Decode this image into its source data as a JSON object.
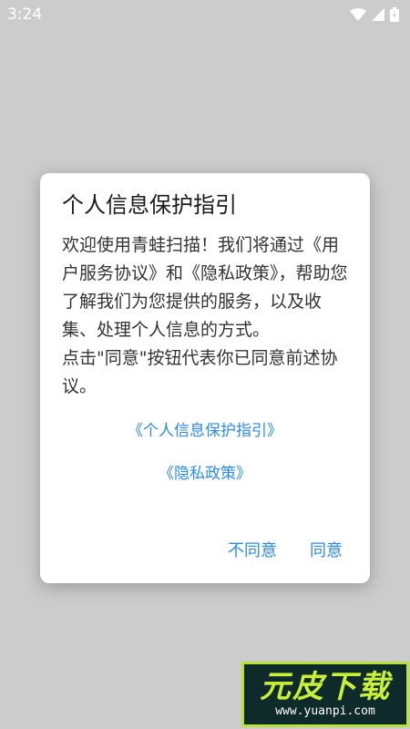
{
  "status_bar": {
    "time": "3:24",
    "icons": [
      "wifi-icon",
      "signal-icon",
      "battery-icon"
    ]
  },
  "dialog": {
    "title": "个人信息保护指引",
    "body_paragraph_1": "欢迎使用青蛙扫描！我们将通过《用户服务协议》和《隐私政策》，帮助您了解我们为您提供的服务，以及收集、处理个人信息的方式。",
    "body_paragraph_2": "点击\"同意\"按钮代表你已同意前述协议。",
    "link_personal_info": "《个人信息保护指引》",
    "link_privacy": "《隐私政策》",
    "disagree_label": "不同意",
    "agree_label": "同意"
  },
  "watermark": {
    "main": "元皮下载",
    "url": "www.yuanpi.com"
  },
  "colors": {
    "background": "#cccccc",
    "accent": "#2d8bea",
    "dialog_bg": "#ffffff"
  }
}
